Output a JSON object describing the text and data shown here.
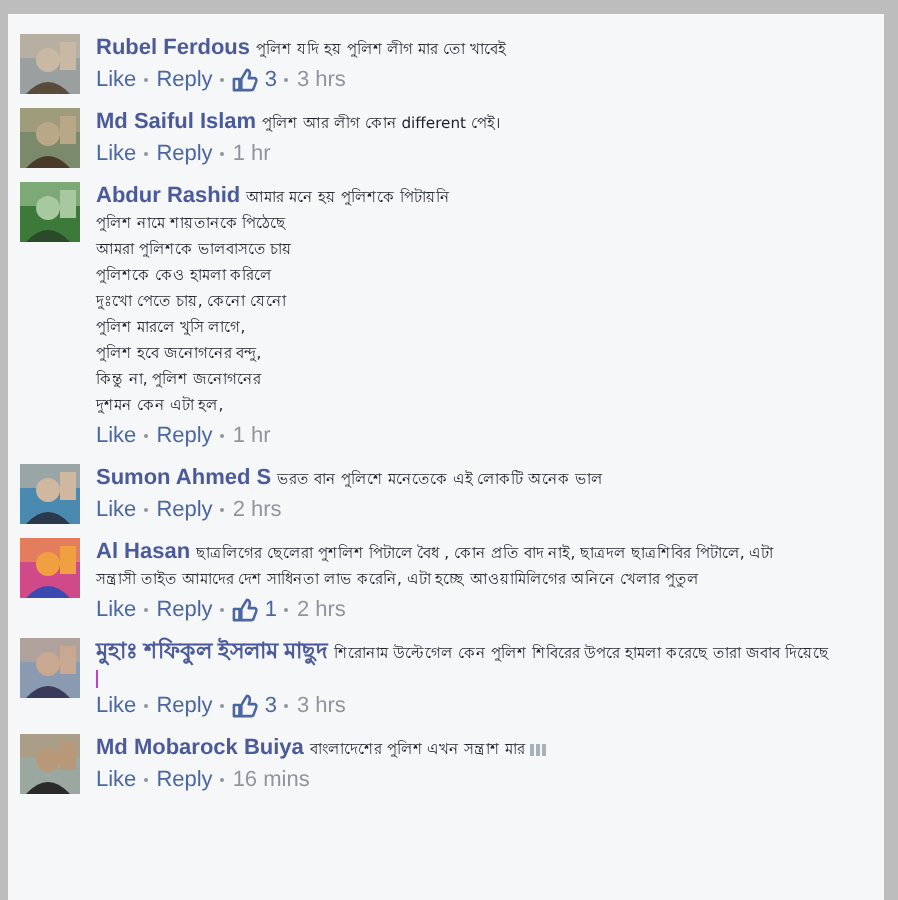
{
  "comments": [
    {
      "author": "Rubel Ferdous",
      "lines": [
        "পুলিশ যদি হয় পুলিশ লীগ মার তো খাবেই"
      ],
      "like": "Like",
      "reply": "Reply",
      "likes": "3",
      "time": "3 hrs"
    },
    {
      "author": "Md Saiful Islam",
      "lines": [
        "পুলিশ আর লীগ কোন different পেই।"
      ],
      "like": "Like",
      "reply": "Reply",
      "time": "1 hr"
    },
    {
      "author": "Abdur Rashid",
      "lines": [
        "আমার মনে হয় পুলিশকে পিটায়নি",
        "পুলিশ নামে শায়তানকে পিঠেছে",
        "আমরা পুলিশকে ভালবাসতে চায়",
        "পুলিশকে কেও হামলা করিলে",
        "দুঃখো পেতে চায়, কেনো যেনো",
        "পুলিশ মারলে খুসি লাগে,",
        "পুলিশ হবে জনোগনের বন্দু,",
        "কিন্তু না, পুলিশ জনোগনের",
        "দুশমন কেন এটা হল,"
      ],
      "like": "Like",
      "reply": "Reply",
      "time": "1 hr"
    },
    {
      "author": "Sumon Ahmed S",
      "lines": [
        "ভরত বান পুলিশে মনেতেকে এই লোকটি অনেক ভাল"
      ],
      "like": "Like",
      "reply": "Reply",
      "time": "2 hrs"
    },
    {
      "author": "Al Hasan",
      "lines": [
        "ছাত্রলিগের ছেলেরা পুশলিশ পিটালে বৈধ , কোন প্রতি বাদ নাই, ছাত্রদল ছাত্রশিবির পিটালে, এটা",
        "সন্ত্রাসী তাইত আমাদের দেশ সাধিনতা লাভ করেনি, এটা হচ্ছে আওয়ামিলিগের অনিনে খেলার পুতুল"
      ],
      "like": "Like",
      "reply": "Reply",
      "likes": "1",
      "time": "2 hrs"
    },
    {
      "author": "মুহাঃ শফিকুল ইসলাম মাছুদ",
      "lines": [
        "শিরোনাম উল্টেগেল কেন পুলিশ শিবিরের উপরে হামলা করেছে তারা জবাব দিয়েছে"
      ],
      "cursor": true,
      "like": "Like",
      "reply": "Reply",
      "likes": "3",
      "time": "3 hrs"
    },
    {
      "author": "Md Mobarock Buiya",
      "lines": [
        "বাংলাদেশের পুলিশ এখন সন্ত্রাশ মার"
      ],
      "emoji": true,
      "like": "Like",
      "reply": "Reply",
      "time": "16 mins"
    }
  ]
}
